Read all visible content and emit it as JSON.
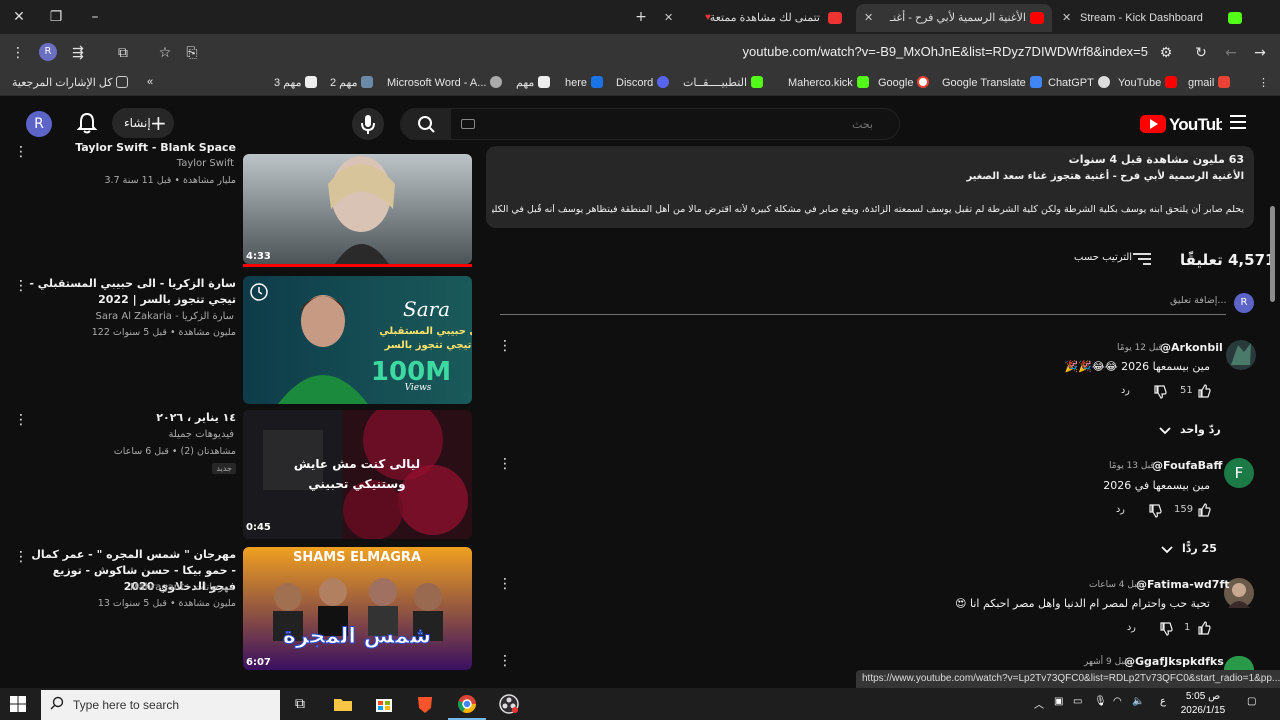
{
  "browser": {
    "tabs": [
      {
        "label": "Stream - Kick Dashboard",
        "active": false,
        "favicon": "kick-icon"
      },
      {
        "label": "الأغنية الرسمية لأبي فرح - أغنـ",
        "active": true,
        "favicon": "youtube-icon"
      },
      {
        "label": "تتمنى لك مشاهدة ممتعة",
        "active": false,
        "favicon": "media-icon"
      }
    ],
    "url": "youtube.com/watch?v=-B9_MxOhJnE&list=RDyz7DIWDWrf8&index=5",
    "bookmarks": [
      {
        "label": "gmail",
        "icon": "gmail-icon"
      },
      {
        "label": "YouTube",
        "icon": "youtube-icon"
      },
      {
        "label": "ChatGPT",
        "icon": "chatgpt-icon"
      },
      {
        "label": "Google Translate",
        "icon": "translate-icon"
      },
      {
        "label": "Google",
        "icon": "google-icon"
      },
      {
        "label": "Maherco.kick",
        "icon": "kick-icon"
      },
      {
        "label": "التطبيــــقــات",
        "icon": "kick-icon"
      },
      {
        "label": "Discord",
        "icon": "discord-icon"
      },
      {
        "label": "here",
        "icon": "shazam-icon"
      },
      {
        "label": "مهم",
        "icon": "qr-icon"
      },
      {
        "label": "Microsoft Word - A...",
        "icon": "globe-icon"
      },
      {
        "label": "مهم 2",
        "icon": "shield-icon"
      },
      {
        "label": "مهم 3",
        "icon": "qr-icon"
      },
      {
        "label": "كل الإشارات المرجعية",
        "icon": "folder-icon"
      }
    ]
  },
  "youtube": {
    "create_label": "إنشاء",
    "search_placeholder": "بحث",
    "logo_text": "YouTube",
    "avatar_letter": "R"
  },
  "related": [
    {
      "title": "Taylor Swift - Blank Space",
      "channel": "Taylor Swift",
      "meta": "3.7 مليار مشاهدة • قبل 11 سنة",
      "duration": "4:33"
    },
    {
      "title": "سارة الزكريا - الى حبيبي المستقبلي - تيجي تتجوز بالسر | 2022",
      "channel": "Sara Al Zakaria - سارة الزكريا",
      "meta": "122 مليون مشاهدة • قبل 5 سنوات",
      "duration": "",
      "thumb_text_1": "Sara",
      "thumb_text_2": "الى حبيبي المستقبلي",
      "thumb_text_3": "تيجي تتجوز بالسر",
      "thumb_text_4": "100M",
      "thumb_text_5": "Views"
    },
    {
      "title": "١٤ يناير ، ٢٠٢٦",
      "channel": "فيديوهات جميلة",
      "meta": "مشاهدتان (2) • قبل 6 ساعات",
      "badge": "جديد",
      "duration": "0:45",
      "thumb_text_1": "ليالى كنت مش عايش",
      "thumb_text_2": "وستنيكي تحبيني"
    },
    {
      "title": "مهرجان \" شمس المجره \" - عمر كمال - حمو بيكا - حسن شاكوش - توزيع فيجو الدخلاوي 2020",
      "channel": "Mahragant - مهرجانات",
      "meta": "13 مليون مشاهدة • قبل 5 سنوات",
      "duration": "6:07",
      "thumb_text_1": "SHAMS ELMAGRA",
      "thumb_text_2": "شمس المجرة"
    }
  ],
  "description": {
    "line1": "63 مليون مشاهدة  قبل 4 سنوات",
    "line2": "الأغنية الرسمية لأبي فرح - أغنية هتجوز غناء سعد الصغير",
    "line3": "يحلم صابر أن يلتحق ابنه يوسف بكلية الشرطة ولكن كلية الشرطة لم تقبل يوسف لسمعته الزائدة، ويقع صابر في مشكلة كبيرة لأنه اقترض مالًا من أهل المنطقة فيتظاهر يوسف أنه قُبل في الكلية ويلـ ...المزيد"
  },
  "comments_header": {
    "count": "4,571 تعليقًا",
    "sort_label": "الترتيب حسب",
    "add_placeholder": "إضافة تعليق..."
  },
  "comments": [
    {
      "user": "@Arkonbil",
      "time": "قبل 12 يومًا",
      "text": "مين بيسمعها 2026 😂😂🎉🎉",
      "likes": "51",
      "reply_label": "رد",
      "replies": "ردّ واحد"
    },
    {
      "user": "@FoufaBaff",
      "time": "قبل 13 يومًا",
      "text": "مين بيسمعها في 2026",
      "likes": "159",
      "reply_label": "رد",
      "replies": "25 ردًّا",
      "avatar_letter": "F"
    },
    {
      "user": "@Fatima-wd7ft",
      "time": "قبل 4 ساعات",
      "text": "تحية حب واحترام لمصر ام الدنيا واهل مصر احبكم انا 😍",
      "likes": "1",
      "reply_label": "رد"
    },
    {
      "user": "@GgafJkspkdfks",
      "time": "قبل 9 أشهر",
      "text": ""
    }
  ],
  "status_url": "https://www.youtube.com/watch?v=Lp2Tv73QFC0&list=RDLp2Tv73QFC0&start_radio=1&pp...",
  "taskbar": {
    "search_placeholder": "Type here to search",
    "time": "5:05 ص",
    "date": "2026/1/15",
    "lang": "ع"
  },
  "colors": {
    "accent": "#ff0000",
    "kick": "#53fc18",
    "bg": "#0f0f0f"
  }
}
